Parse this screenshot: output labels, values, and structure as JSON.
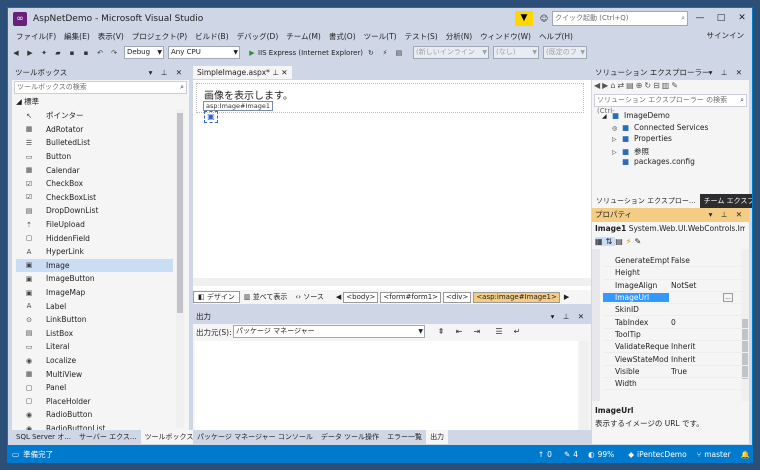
{
  "window": {
    "title": "AspNetDemo - Microsoft Visual Studio",
    "quick_launch_placeholder": "クイック起動 (Ctrl+Q)",
    "minimize": "—",
    "maximize": "□",
    "close": "✕",
    "signin": "サインイン"
  },
  "menu": [
    "ファイル(F)",
    "編集(E)",
    "表示(V)",
    "プロジェクト(P)",
    "ビルド(B)",
    "デバッグ(D)",
    "チーム(M)",
    "書式(O)",
    "ツール(T)",
    "テスト(S)",
    "分析(N)",
    "ウィンドウ(W)",
    "ヘルプ(H)"
  ],
  "toolbar": {
    "config": "Debug",
    "platform": "Any CPU",
    "run": "IIS Express (Internet Explorer)",
    "style_combo": "(新しいインライン",
    "font_combo": "(なし)",
    "size_combo": "(既定のフ"
  },
  "toolbox": {
    "header": "ツールボックス",
    "search_placeholder": "ツールボックスの検索",
    "group": "標準",
    "items": [
      {
        "label": "ポインター",
        "icon": "pointer-icon",
        "glyph": "↖"
      },
      {
        "label": "AdRotator",
        "icon": "adrotator-icon",
        "glyph": "▦"
      },
      {
        "label": "BulletedList",
        "icon": "bulleted-list-icon",
        "glyph": "☰"
      },
      {
        "label": "Button",
        "icon": "button-icon",
        "glyph": "▭"
      },
      {
        "label": "Calendar",
        "icon": "calendar-icon",
        "glyph": "▦"
      },
      {
        "label": "CheckBox",
        "icon": "checkbox-icon",
        "glyph": "☑"
      },
      {
        "label": "CheckBoxList",
        "icon": "checkbox-list-icon",
        "glyph": "☑"
      },
      {
        "label": "DropDownList",
        "icon": "dropdown-list-icon",
        "glyph": "▤"
      },
      {
        "label": "FileUpload",
        "icon": "file-upload-icon",
        "glyph": "⇡"
      },
      {
        "label": "HiddenField",
        "icon": "hidden-field-icon",
        "glyph": "▢"
      },
      {
        "label": "HyperLink",
        "icon": "hyperlink-icon",
        "glyph": "A"
      },
      {
        "label": "Image",
        "icon": "image-icon",
        "glyph": "▣"
      },
      {
        "label": "ImageButton",
        "icon": "image-button-icon",
        "glyph": "▣"
      },
      {
        "label": "ImageMap",
        "icon": "image-map-icon",
        "glyph": "▣"
      },
      {
        "label": "Label",
        "icon": "label-icon",
        "glyph": "A"
      },
      {
        "label": "LinkButton",
        "icon": "link-button-icon",
        "glyph": "⊙"
      },
      {
        "label": "ListBox",
        "icon": "listbox-icon",
        "glyph": "▤"
      },
      {
        "label": "Literal",
        "icon": "literal-icon",
        "glyph": "▭"
      },
      {
        "label": "Localize",
        "icon": "localize-icon",
        "glyph": "◉"
      },
      {
        "label": "MultiView",
        "icon": "multiview-icon",
        "glyph": "▦"
      },
      {
        "label": "Panel",
        "icon": "panel-icon",
        "glyph": "▢"
      },
      {
        "label": "PlaceHolder",
        "icon": "placeholder-icon",
        "glyph": "▢"
      },
      {
        "label": "RadioButton",
        "icon": "radio-button-icon",
        "glyph": "◉"
      },
      {
        "label": "RadioButtonList",
        "icon": "radio-button-list-icon",
        "glyph": "◉"
      }
    ],
    "bottom_tabs": [
      "SQL Server オ...",
      "サーバー エクス...",
      "ツールボックス"
    ]
  },
  "editor": {
    "tab": "SimpleImage.aspx*",
    "heading": "画像を表示します。",
    "tag_label": "asp:Image#Image1",
    "view_tabs": [
      "デザイン",
      "並べて表示",
      "ソース"
    ],
    "breadcrumbs": [
      "<body>",
      "<form#form1>",
      "<div>",
      "<asp:image#Image1>"
    ]
  },
  "output": {
    "header": "出力",
    "source_label": "出力元(S):",
    "source_value": "パッケージ マネージャー",
    "bottom_tabs": [
      "パッケージ マネージャー コンソール",
      "データ ツール操作",
      "エラー一覧",
      "出力"
    ]
  },
  "solution": {
    "header": "ソリューション エクスプローラー",
    "search_placeholder": "ソリューション エクスプローラー の検索 (Ctrl-",
    "items": [
      {
        "label": "ImageDemo",
        "level": 0,
        "glyph": "◢"
      },
      {
        "label": "Connected Services",
        "level": 1,
        "glyph": "◎"
      },
      {
        "label": "Properties",
        "level": 1,
        "glyph": "▷"
      },
      {
        "label": "参照",
        "level": 1,
        "glyph": "▷"
      },
      {
        "label": "packages.config",
        "level": 1,
        "glyph": ""
      }
    ],
    "bottom_tabs": [
      "ソリューション エクスプロー...",
      "チーム エクスプローラー"
    ]
  },
  "properties": {
    "header": "プロパティ",
    "object_name": "Image1",
    "object_type": "System.Web.UI.WebControls.Ima",
    "rows": [
      {
        "name": "GenerateEmptyAlt",
        "value": "False"
      },
      {
        "name": "Height",
        "value": ""
      },
      {
        "name": "ImageAlign",
        "value": "NotSet"
      },
      {
        "name": "ImageUrl",
        "value": ""
      },
      {
        "name": "SkinID",
        "value": ""
      },
      {
        "name": "TabIndex",
        "value": "0"
      },
      {
        "name": "ToolTip",
        "value": ""
      },
      {
        "name": "ValidateRequestM",
        "value": "Inherit"
      },
      {
        "name": "ViewStateMode",
        "value": "Inherit"
      },
      {
        "name": "Visible",
        "value": "True"
      },
      {
        "name": "Width",
        "value": ""
      }
    ],
    "desc_title": "ImageUrl",
    "desc_text": "表示するイメージの URL です。"
  },
  "status": {
    "ready": "準備完了",
    "up": "0",
    "pencil": "4",
    "zoom": "99%",
    "project": "iPentecDemo",
    "branch": "master",
    "accent": "#007acc"
  }
}
